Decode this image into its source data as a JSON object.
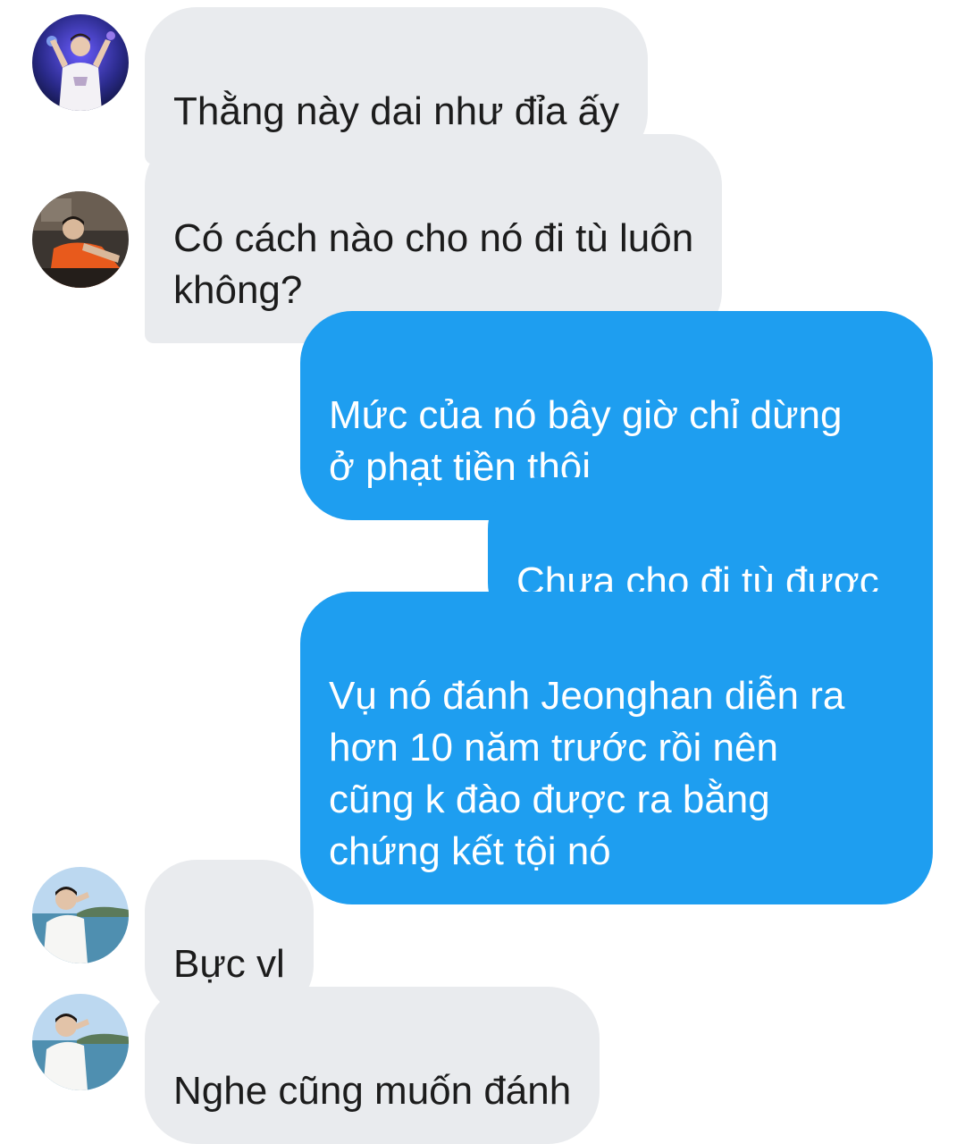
{
  "conversation": {
    "messages": [
      {
        "sender": "other",
        "text": "Thằng này dai như đỉa ấy"
      },
      {
        "sender": "other",
        "text": "Có cách nào cho nó đi tù luôn\nkhông?"
      },
      {
        "sender": "me",
        "text": "Mức của nó bây giờ chỉ dừng\nở phạt tiền thôi"
      },
      {
        "sender": "me",
        "text": "Chưa cho đi tù được"
      },
      {
        "sender": "me",
        "text": "Vụ nó đánh Jeonghan diễn ra\nhơn 10 năm trước rồi nên\ncũng k đào được ra bằng\nchứng kết tội nó"
      },
      {
        "sender": "other",
        "text": "Bực vl"
      },
      {
        "sender": "other",
        "text": "Nghe cũng muốn đánh"
      }
    ]
  },
  "colors": {
    "incoming_bubble": "#e9ebee",
    "outgoing_bubble": "#1e9ef0",
    "incoming_text": "#1c1c1c",
    "outgoing_text": "#ffffff"
  },
  "avatars": [
    {
      "icon": "user-avatar-concert"
    },
    {
      "icon": "user-avatar-orange-shirt"
    },
    {
      "icon": "user-avatar-seaside"
    },
    {
      "icon": "user-avatar-seaside"
    }
  ]
}
